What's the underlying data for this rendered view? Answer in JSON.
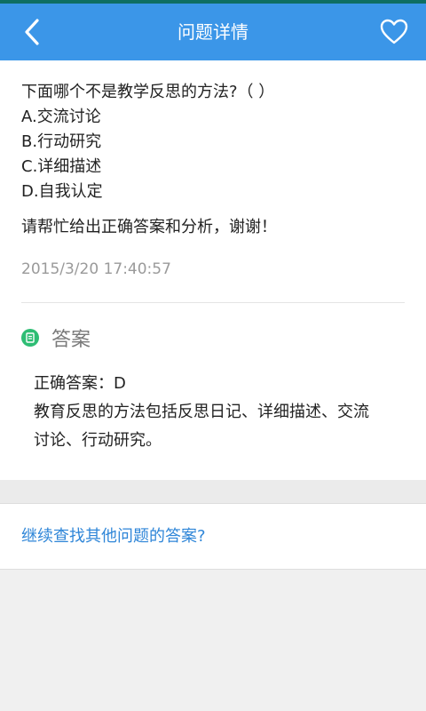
{
  "header": {
    "title": "问题详情",
    "back_icon": "chevron-left-icon",
    "favorite_icon": "heart-outline-icon",
    "bar_color": "#3b96e8"
  },
  "question": {
    "text": "下面哪个不是教学反思的方法?（ ）",
    "options": [
      "A.交流讨论",
      "B.行动研究",
      "C.详细描述",
      "D.自我认定"
    ],
    "request": "请帮忙给出正确答案和分析，谢谢！",
    "timestamp": "2015/3/20 17:40:57"
  },
  "answer": {
    "label": "答案",
    "icon": "answer-document-icon",
    "icon_color": "#2ebd74",
    "correct": "正确答案：D",
    "analysis_line1": "教育反思的方法包括反思日记、详细描述、交流",
    "analysis_line2": "讨论、行动研究。"
  },
  "footer": {
    "continue_link": "继续查找其他问题的答案?",
    "link_color": "#2f86d8"
  }
}
